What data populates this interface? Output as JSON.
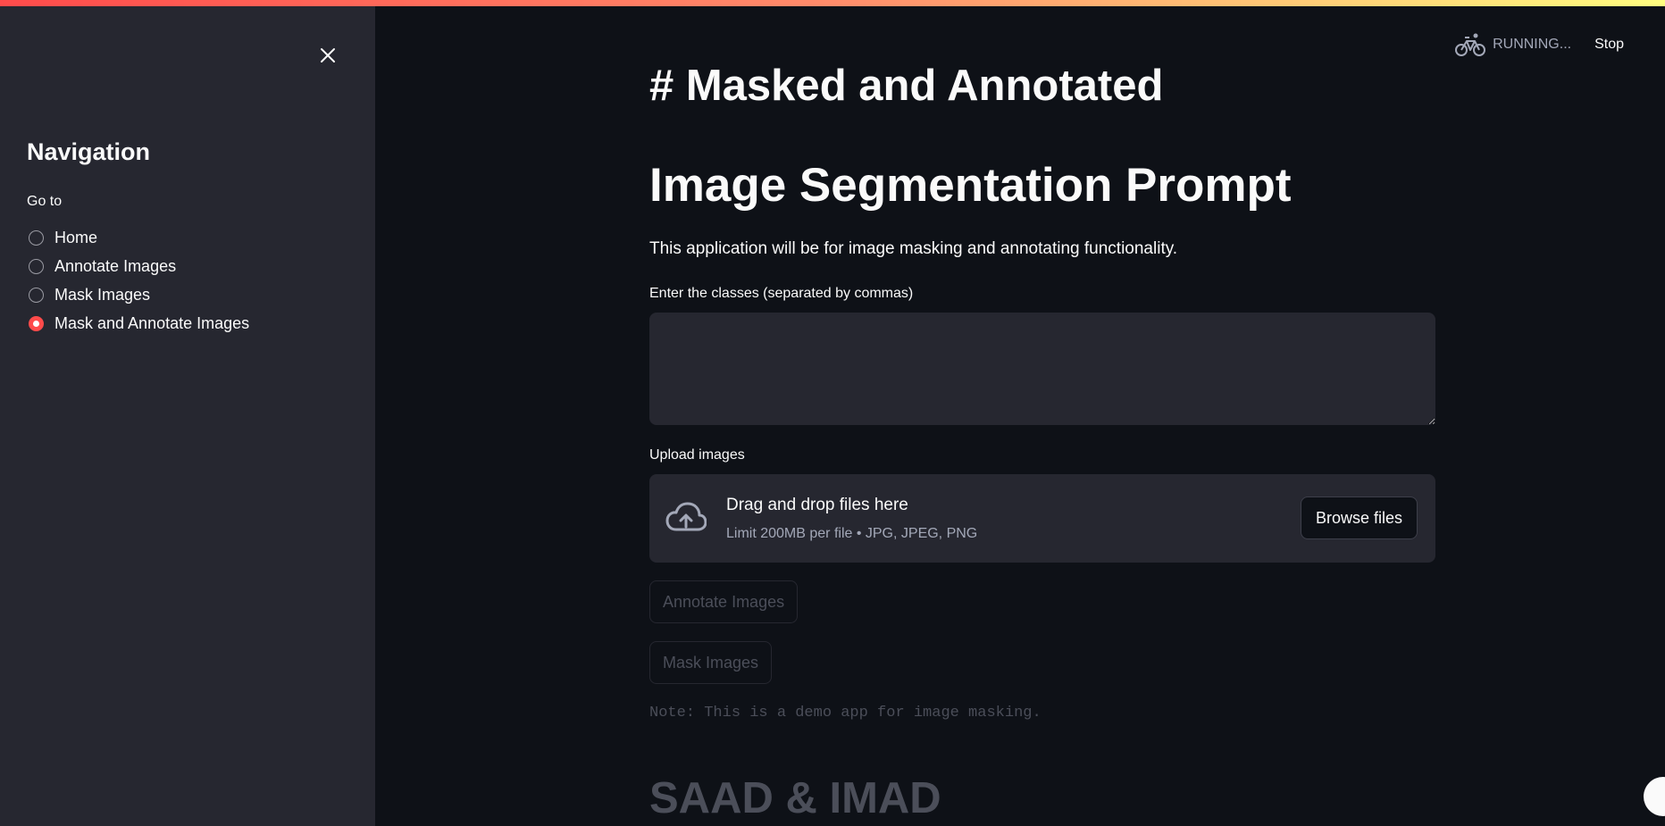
{
  "sidebar": {
    "title": "Navigation",
    "goto_label": "Go to",
    "options": [
      {
        "label": "Home",
        "selected": false
      },
      {
        "label": "Annotate Images",
        "selected": false
      },
      {
        "label": "Mask Images",
        "selected": false
      },
      {
        "label": "Mask and Annotate Images",
        "selected": true
      }
    ]
  },
  "status": {
    "running_text": "RUNNING...",
    "stop_label": "Stop"
  },
  "main": {
    "heading_masked": "# Masked and Annotated",
    "heading_segmentation": "Image Segmentation Prompt",
    "description": "This application will be for image masking and annotating functionality.",
    "classes_label": "Enter the classes (separated by commas)",
    "classes_value": "",
    "upload_label": "Upload images",
    "uploader": {
      "title": "Drag and drop files here",
      "limit": "Limit 200MB per file • JPG, JPEG, PNG",
      "browse_label": "Browse files"
    },
    "annotate_button": "Annotate Images",
    "mask_button": "Mask Images",
    "note": "Note: This is a demo app for image masking.",
    "footer_heading": "SAAD & IMAD"
  },
  "colors": {
    "background": "#0e1117",
    "sidebar": "#262730",
    "accent": "#ff4b4b",
    "muted_text": "#a3a8b8",
    "disabled_text": "#4b4e59"
  }
}
